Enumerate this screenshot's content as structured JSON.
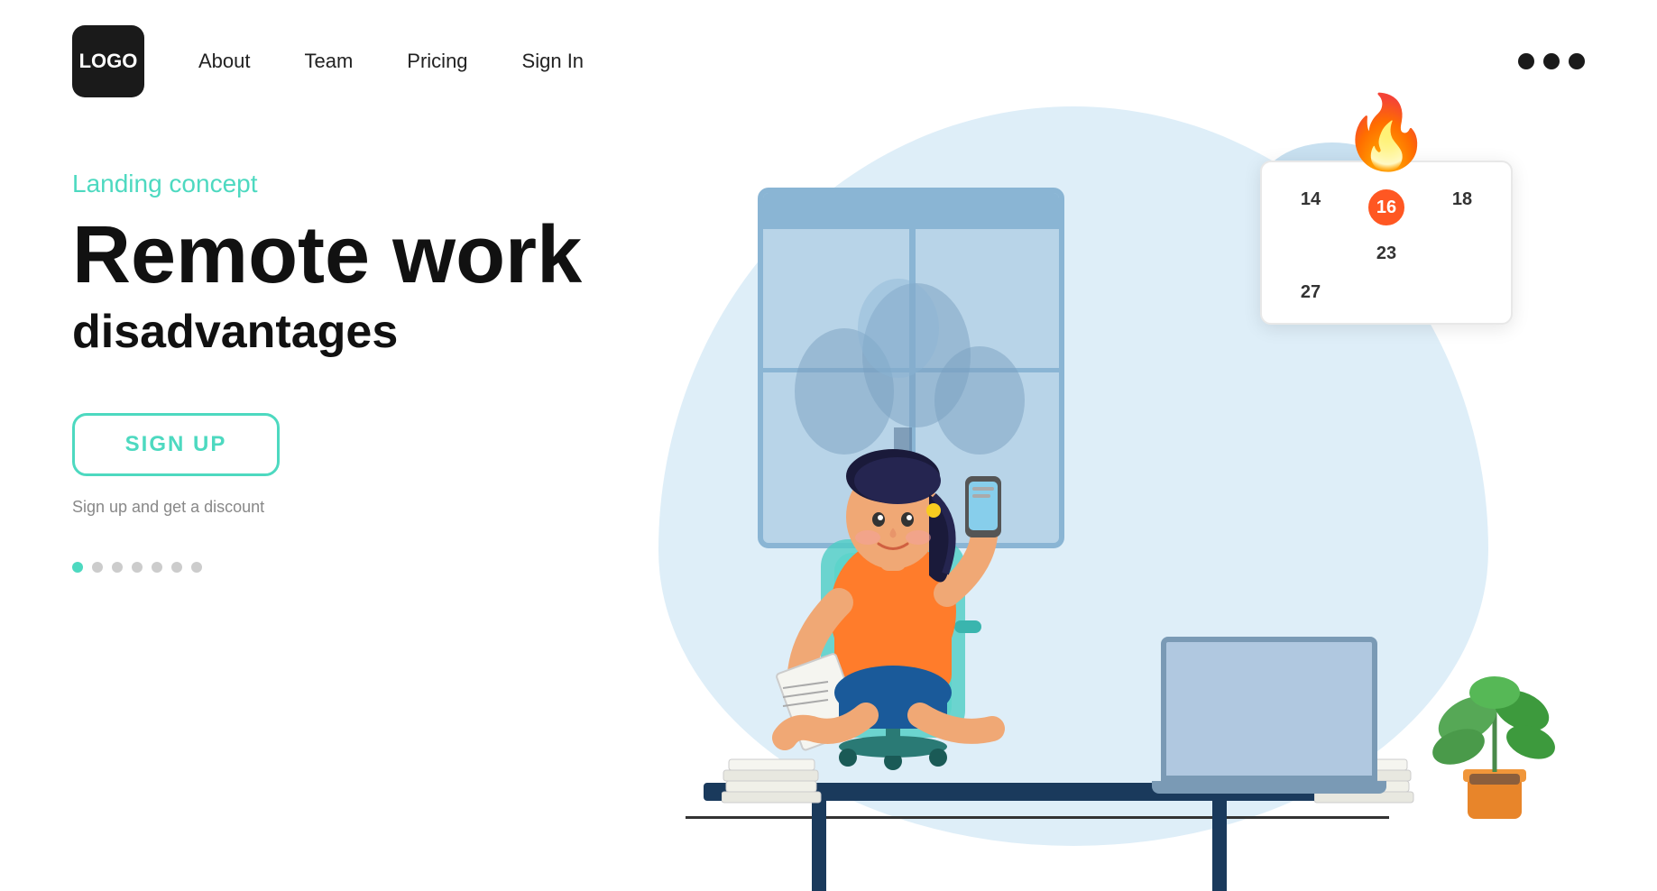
{
  "header": {
    "logo_line1": "LO",
    "logo_line2": "GO",
    "nav": {
      "about": "About",
      "team": "Team",
      "pricing": "Pricing",
      "signin": "Sign In"
    }
  },
  "hero": {
    "label": "Landing concept",
    "title_line1": "Remote work",
    "title_line2": "disadvantages",
    "cta_button": "SIGN UP",
    "cta_caption": "Sign up and get a discount"
  },
  "calendar": {
    "numbers": [
      {
        "value": "14",
        "type": "normal"
      },
      {
        "value": "16",
        "type": "highlighted"
      },
      {
        "value": "18",
        "type": "normal"
      },
      {
        "value": "23",
        "type": "normal"
      },
      {
        "value": "27",
        "type": "normal"
      }
    ]
  },
  "pagination": {
    "dots": [
      {
        "active": true
      },
      {
        "active": false
      },
      {
        "active": false
      },
      {
        "active": false
      },
      {
        "active": false
      },
      {
        "active": false
      },
      {
        "active": false
      }
    ]
  }
}
